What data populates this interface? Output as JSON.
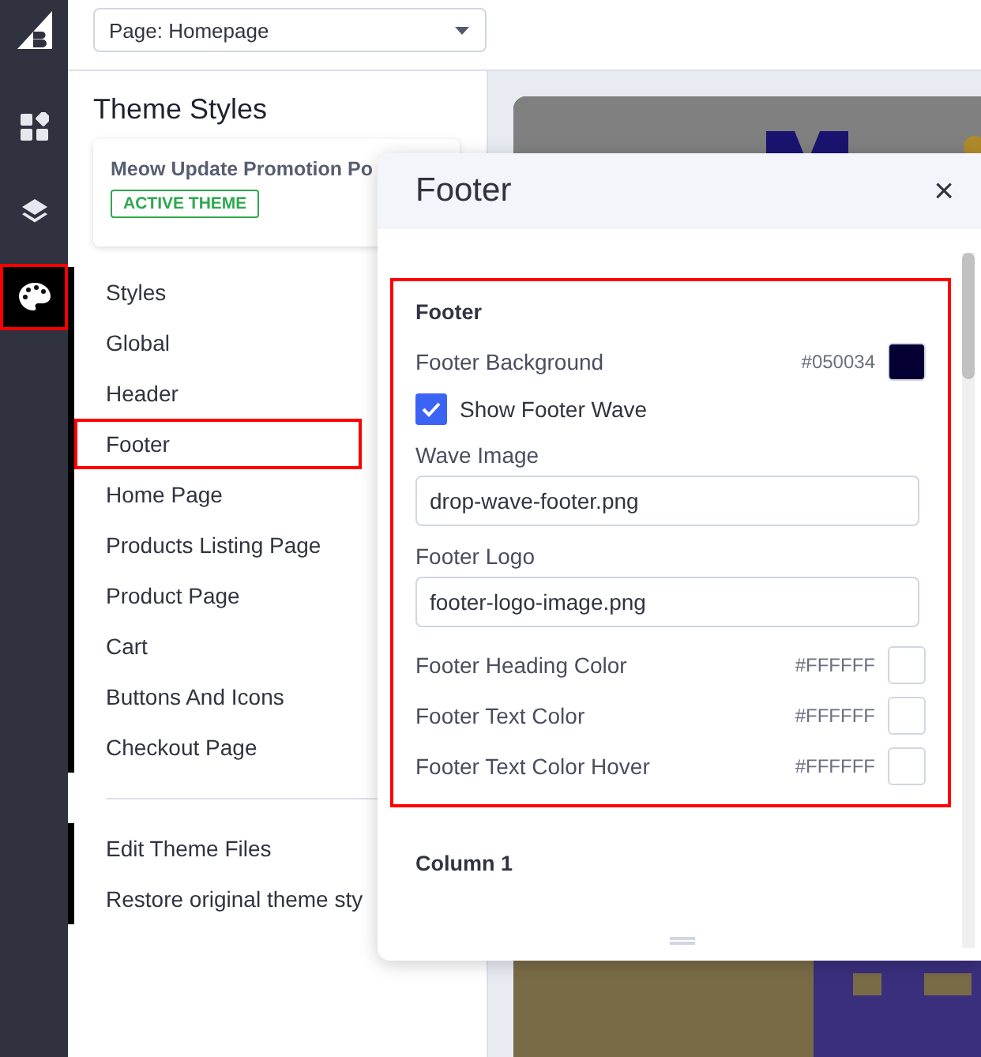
{
  "rail": [
    {
      "kind": "logo",
      "selected": false,
      "highlighted": false
    },
    {
      "kind": "dashboard",
      "selected": false,
      "highlighted": false
    },
    {
      "kind": "layers",
      "selected": false,
      "highlighted": false
    },
    {
      "kind": "palette",
      "selected": true,
      "highlighted": true
    }
  ],
  "page_select": {
    "value": "Page: Homepage"
  },
  "panel": {
    "title": "Theme Styles",
    "theme_card": {
      "name": "Meow Update Promotion Po",
      "badge": "ACTIVE THEME"
    },
    "nav_items": [
      {
        "label": "Styles",
        "highlighted": false
      },
      {
        "label": "Global",
        "highlighted": false
      },
      {
        "label": "Header",
        "highlighted": false
      },
      {
        "label": "Footer",
        "highlighted": true
      },
      {
        "label": "Home Page",
        "highlighted": false
      },
      {
        "label": "Products Listing Page",
        "highlighted": false
      },
      {
        "label": "Product Page",
        "highlighted": false
      },
      {
        "label": "Cart",
        "highlighted": false
      },
      {
        "label": "Buttons And Icons",
        "highlighted": false
      },
      {
        "label": "Checkout Page",
        "highlighted": false
      }
    ],
    "links": [
      {
        "label": "Edit Theme Files"
      },
      {
        "label": "Restore original theme sty"
      }
    ]
  },
  "modal": {
    "title": "Footer",
    "close": "×",
    "sections": [
      {
        "title": "Footer",
        "highlighted": true,
        "fields": [
          {
            "kind": "color",
            "label": "Footer Background",
            "value": "#050034",
            "color": "#050034"
          },
          {
            "kind": "checkbox",
            "label": "Show Footer Wave",
            "checked": true
          },
          {
            "kind": "text",
            "label": "Wave Image",
            "value": "drop-wave-footer.png"
          },
          {
            "kind": "text",
            "label": "Footer Logo",
            "value": "footer-logo-image.png"
          },
          {
            "kind": "color",
            "label": "Footer Heading Color",
            "value": "#FFFFFF",
            "color": "#ffffff"
          },
          {
            "kind": "color",
            "label": "Footer Text Color",
            "value": "#FFFFFF",
            "color": "#ffffff"
          },
          {
            "kind": "color",
            "label": "Footer Text Color Hover",
            "value": "#FFFFFF",
            "color": "#ffffff"
          }
        ]
      },
      {
        "title": "Column 1",
        "highlighted": false
      }
    ]
  }
}
